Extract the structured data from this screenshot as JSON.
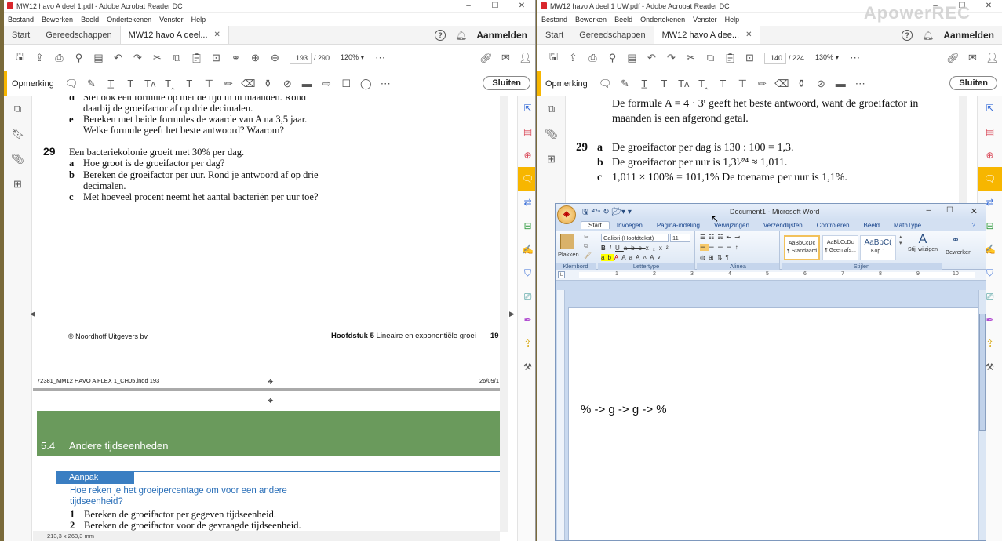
{
  "watermark": "ApowerREC",
  "left": {
    "title": "MW12 havo A deel 1.pdf - Adobe Acrobat Reader DC",
    "menu": [
      "Bestand",
      "Bewerken",
      "Beeld",
      "Ondertekenen",
      "Venster",
      "Help"
    ],
    "tabs": {
      "home": "Start",
      "tools": "Gereedschappen",
      "doc": "MW12 havo A deel...",
      "help": "?",
      "signin": "Aanmelden"
    },
    "page_current": "193",
    "page_total": "/ 290",
    "zoom": "120%",
    "comment_label": "Opmerking",
    "close_label": "Sluiten",
    "content": {
      "d_letter": "d",
      "d_line1": "Stel ook een formule op met de tijd m in maanden. Rond",
      "d_line2": "daarbij de groeifactor af op drie decimalen.",
      "e_letter": "e",
      "e_line1": "Bereken met beide formules de waarde van A na 3,5 jaar.",
      "e_line2": "Welke formule geeft het beste antwoord? Waarom?",
      "q_num": "29",
      "q_text": "Een bacteriekolonie groeit met 30% per dag.",
      "a_letter": "a",
      "a_text": "Hoe groot is de groeifactor per dag?",
      "b_letter": "b",
      "b_line1": "Bereken de groeifactor per uur. Rond je antwoord af op drie",
      "b_line2": "decimalen.",
      "c_letter": "c",
      "c_text": "Met hoeveel procent neemt het aantal bacteriën per uur toe?",
      "footer_left": "© Noordhoff Uitgevers bv",
      "footer_chapter": "Hoofdstuk 5",
      "footer_title": "Lineaire en exponentiële groei",
      "footer_page": "19",
      "print_left": "72381_MM12 HAVO A FLEX 1_CH05.indd 193",
      "print_right": "26/09/1",
      "section_num": "5.4",
      "section_title": "Andere tijdseenheden",
      "box_label": "Aanpak",
      "box_q1": "Hoe reken je het groeipercentage om voor een andere",
      "box_q2": "tijdseenheid?",
      "step1_num": "1",
      "step1": "Bereken de groeifactor per gegeven tijdseenheid.",
      "step2_num": "2",
      "step2": "Bereken de groeifactor voor de gevraagde tijdseenheid.",
      "dims": "213,3 x 263,3 mm"
    }
  },
  "right": {
    "title": "MW12 havo A deel 1 UW.pdf - Adobe Acrobat Reader DC",
    "menu": [
      "Bestand",
      "Bewerken",
      "Beeld",
      "Ondertekenen",
      "Venster",
      "Help"
    ],
    "tabs": {
      "home": "Start",
      "tools": "Gereedschappen",
      "doc": "MW12 havo A dee...",
      "help": "?",
      "signin": "Aanmelden"
    },
    "page_current": "140",
    "page_total": "/ 224",
    "zoom": "130%",
    "comment_label": "Opmerking",
    "close_label": "Sluiten",
    "content": {
      "line1": "De formule A = 4 · 3ᵗ geeft het beste antwoord, want de groeifactor in",
      "line2": "maanden is een afgerond getal.",
      "q_num": "29",
      "a_letter": "a",
      "a_text": "De groeifactor per dag is 130 : 100 = 1,3.",
      "b_letter": "b",
      "b_text": "De groeifactor per uur is 1,3¹⁄²⁴ ≈ 1,011.",
      "c_letter": "c",
      "c_text": "1,011 × 100% = 101,1% De toename per uur is 1,1%."
    }
  },
  "word": {
    "title": "Document1 - Microsoft Word",
    "tabs": [
      "Start",
      "Invoegen",
      "Pagina-indeling",
      "Verwijzingen",
      "Verzendlijsten",
      "Controleren",
      "Beeld",
      "MathType"
    ],
    "active_tab": "Start",
    "groups": {
      "clipboard": "Klembord",
      "font": "Lettertype",
      "paragraph": "Alinea",
      "styles": "Stijlen"
    },
    "paste_label": "Plakken",
    "font_name": "Calibri (Hoofdtekst)",
    "font_size": "11",
    "styles": [
      {
        "preview": "AaBbCcDc",
        "name": "¶ Standaard"
      },
      {
        "preview": "AaBbCcDc",
        "name": "¶ Geen afs..."
      },
      {
        "preview": "AaBbC(",
        "name": "Kop 1"
      }
    ],
    "change_styles": "Stijl wijzigen",
    "edit_label": "Bewerken",
    "ruler_numbers": [
      "1",
      "2",
      "3",
      "4",
      "5",
      "6",
      "7",
      "8",
      "9",
      "10"
    ],
    "body_text": "% -> g -> g -> %"
  }
}
